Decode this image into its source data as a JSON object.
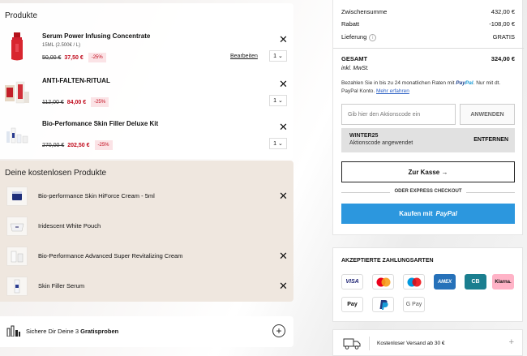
{
  "cart": {
    "title": "Produkte",
    "items": [
      {
        "name": "Serum Power Infusing Concentrate",
        "sub": "15ML (2.500€ / L)",
        "old_price": "50,00 €",
        "new_price": "37,50 €",
        "discount": "-25%",
        "edit": "Bearbeiten",
        "qty": "1"
      },
      {
        "name": "ANTI-FALTEN-RITUAL",
        "sub": "",
        "old_price": "112,00 €",
        "new_price": "84,00 €",
        "discount": "-25%",
        "edit": "",
        "qty": "1"
      },
      {
        "name": "Bio-Perfomance Skin Filler Deluxe Kit",
        "sub": "",
        "old_price": "270,00 €",
        "new_price": "202,50 €",
        "discount": "-25%",
        "edit": "",
        "qty": "1"
      }
    ]
  },
  "free_products": {
    "title": "Deine kostenlosen Produkte",
    "items": [
      {
        "name": "Bio-performance Skin HiForce Cream - 5ml"
      },
      {
        "name": "Iridescent White Pouch"
      },
      {
        "name": "Bio-Performance Advanced Super Revitalizing Cream"
      },
      {
        "name": "Skin Filler Serum"
      }
    ]
  },
  "samples": {
    "text_prefix": "Sichere Dir Deine 3 ",
    "text_bold": "Gratisproben"
  },
  "summary": {
    "subtotal_label": "Zwischensumme",
    "subtotal_value": "432,00 €",
    "discount_label": "Rabatt",
    "discount_value": "-108,00 €",
    "delivery_label": "Lieferung",
    "delivery_value": "GRATIS",
    "total_label": "GESAMT",
    "total_value": "324,00 €",
    "vat_note": "inkl. MwSt.",
    "paypal_note_1": "Bezahlen Sie in bis zu 24 monatlichen Raten mit",
    "paypal_note_2": ". Nur mit dt. PayPal Konto.",
    "paypal_more": "Mehr erfahren",
    "paypal_brand_1": "Pay",
    "paypal_brand_2": "Pal"
  },
  "coupon": {
    "placeholder": "Gib hier den Aktionscode ein",
    "apply": "ANWENDEN",
    "code": "WINTER25",
    "applied_msg": "Aktionscode angewendet",
    "remove": "ENTFERNEN"
  },
  "checkout": {
    "button": "Zur Kasse →",
    "express_label": "ODER EXPRESS CHECKOUT",
    "paypal_button_prefix": "Kaufen mit",
    "paypal_button_brand": "PayPal"
  },
  "payment": {
    "title": "AKZEPTIERTE ZAHLUNGSARTEN",
    "methods": [
      "VISA",
      "Mastercard",
      "Maestro",
      "AMEX",
      "CB",
      "Klarna.",
      "Apple Pay",
      "PayPal",
      "G Pay"
    ],
    "apple_pay_label": "Pay",
    "gpay_label": "G Pay",
    "visa_label": "VISA",
    "amex_label": "AMEX",
    "cb_label": "CB",
    "klarna_label": "Klarna."
  },
  "shipping": {
    "label": "Kostenloser Versand ab 30 €"
  },
  "colors": {
    "accent_red": "#c0081a",
    "paypal_blue": "#2c97de",
    "free_bg": "#efe7df"
  },
  "icons": {
    "close": "close-icon",
    "chevron": "chevron-down-icon",
    "info": "info-icon",
    "plus": "plus-circle-icon",
    "truck": "truck-icon",
    "samples": "sample-bottles-icon"
  }
}
